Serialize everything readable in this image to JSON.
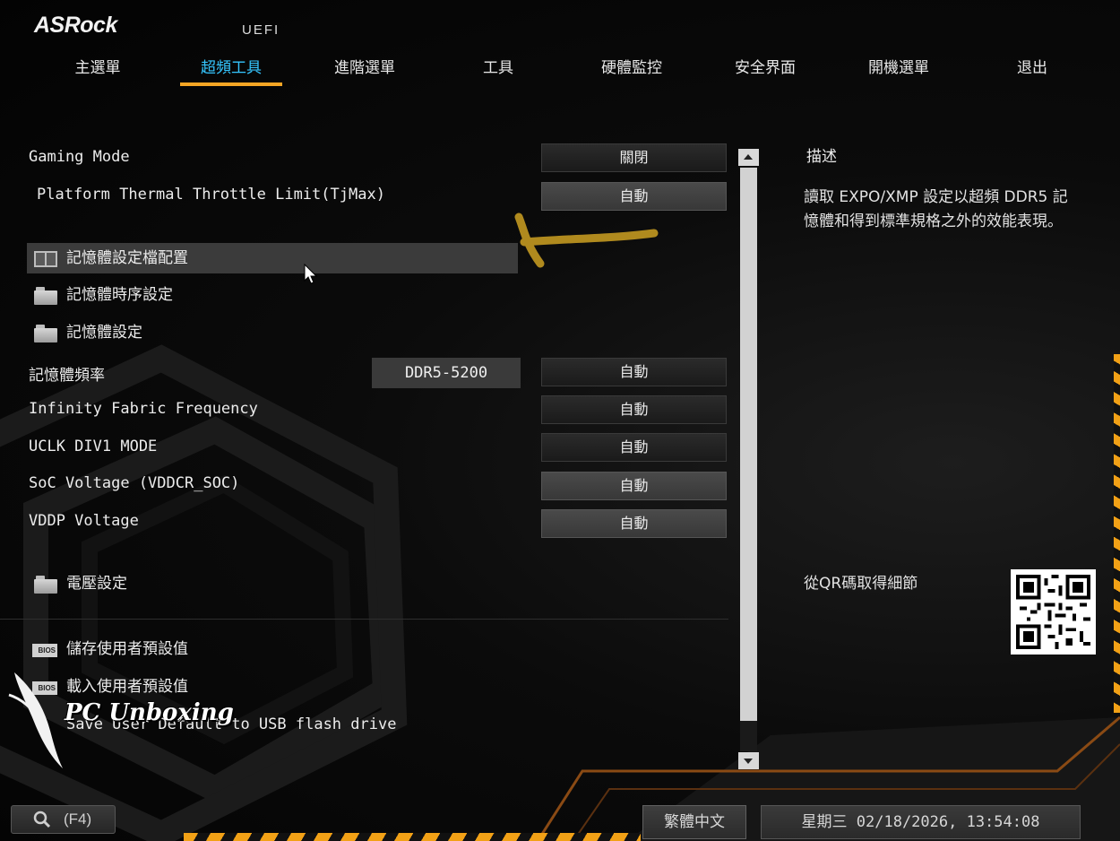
{
  "brand": {
    "logo": "ASRock",
    "firmware": "UEFI"
  },
  "nav": {
    "tabs": [
      {
        "label": "主選單",
        "active": false
      },
      {
        "label": "超頻工具",
        "active": true
      },
      {
        "label": "進階選單",
        "active": false
      },
      {
        "label": "工具",
        "active": false
      },
      {
        "label": "硬體監控",
        "active": false
      },
      {
        "label": "安全界面",
        "active": false
      },
      {
        "label": "開機選單",
        "active": false
      },
      {
        "label": "退出",
        "active": false
      }
    ]
  },
  "settings": {
    "gaming_mode": {
      "label": "Gaming Mode",
      "value": "關閉"
    },
    "thermal_limit": {
      "label": "Platform Thermal Throttle Limit(TjMax)",
      "value": "自動"
    },
    "mem_profile": {
      "label": "記憶體設定檔配置"
    },
    "mem_timing": {
      "label": "記憶體時序設定"
    },
    "mem_config": {
      "label": "記憶體設定"
    },
    "mem_freq": {
      "label": "記憶體頻率",
      "current": "DDR5-5200",
      "value": "自動"
    },
    "infinity_fabric": {
      "label": "Infinity Fabric Frequency",
      "value": "自動"
    },
    "uclk": {
      "label": "UCLK DIV1 MODE",
      "value": "自動"
    },
    "soc_voltage": {
      "label": "SoC Voltage (VDDCR_SOC)",
      "value": "自動"
    },
    "vddp_voltage": {
      "label": "VDDP Voltage",
      "value": "自動"
    },
    "voltage_config": {
      "label": "電壓設定"
    },
    "save_user_defaults": {
      "label": "儲存使用者預設值",
      "icon_text": "BIOS"
    },
    "load_user_defaults": {
      "label": "載入使用者預設值",
      "icon_text": "BIOS"
    },
    "save_usb": {
      "label": "Save User Default to USB flash drive"
    }
  },
  "description": {
    "title": "描述",
    "text": "讀取 EXPO/XMP 設定以超頻 DDR5 記憶體和得到標準規格之外的效能表現。",
    "qr_label": "從QR碼取得細節"
  },
  "footer": {
    "search_key": "(F4)",
    "language": "繁體中文",
    "datetime": "星期三 02/18/2026, 13:54:08"
  },
  "watermark": {
    "text": "PC Unboxing"
  },
  "colors": {
    "accent": "#35c6ff",
    "underline": "#f5a524",
    "annotation_arrow": "#b08a1e",
    "stripe": "#f2a116"
  }
}
